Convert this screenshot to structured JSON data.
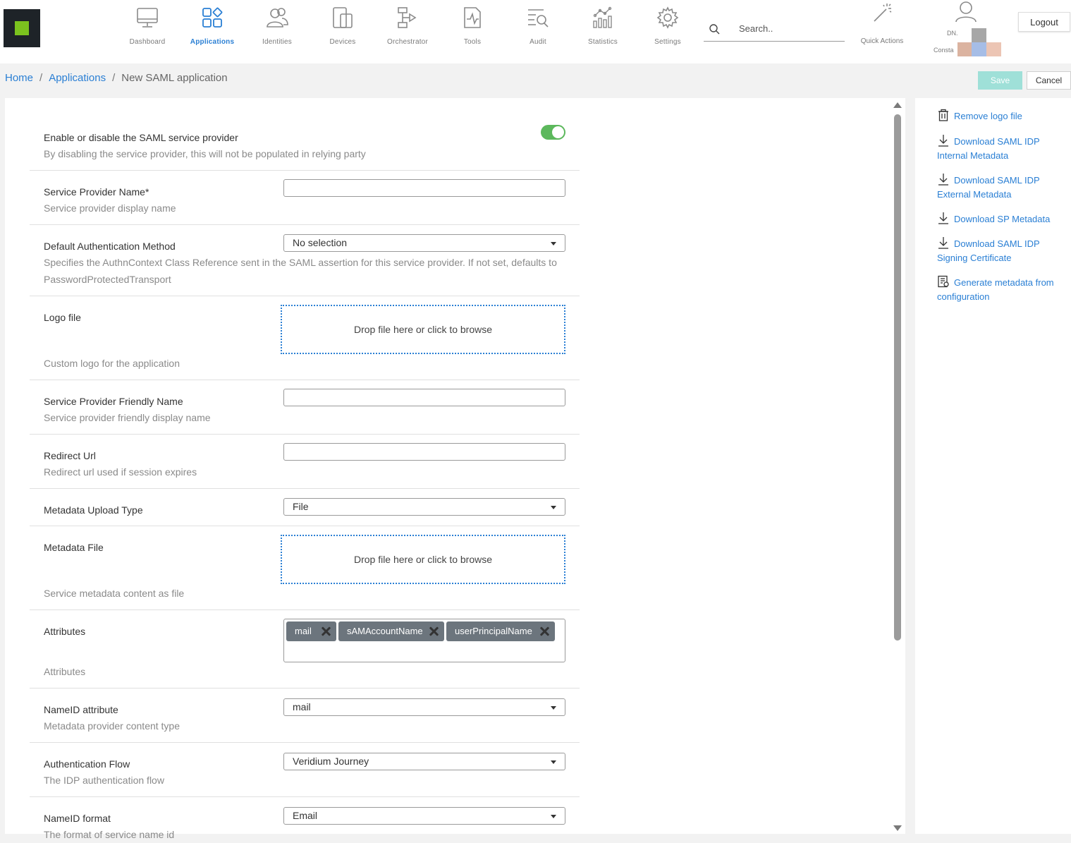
{
  "nav": [
    {
      "label": "Dashboard",
      "icon": "monitor-icon",
      "active": false
    },
    {
      "label": "Applications",
      "icon": "applications-icon",
      "active": true
    },
    {
      "label": "Identities",
      "icon": "identities-icon",
      "active": false
    },
    {
      "label": "Devices",
      "icon": "devices-icon",
      "active": false
    },
    {
      "label": "Orchestrator",
      "icon": "orchestrator-icon",
      "active": false
    },
    {
      "label": "Tools",
      "icon": "tools-icon",
      "active": false
    },
    {
      "label": "Audit",
      "icon": "audit-icon",
      "active": false
    },
    {
      "label": "Statistics",
      "icon": "statistics-icon",
      "active": false
    },
    {
      "label": "Settings",
      "icon": "gear-icon",
      "active": false
    }
  ],
  "search": {
    "placeholder": "Search.."
  },
  "quick_actions": {
    "label": "Quick Actions"
  },
  "user": {
    "dn_label": "DN.",
    "name_partial": "Consta"
  },
  "logout_label": "Logout",
  "breadcrumb": {
    "home": "Home",
    "applications": "Applications",
    "current": "New SAML application"
  },
  "toolbar": {
    "save_label": "Save",
    "cancel_label": "Cancel"
  },
  "form": {
    "enable": {
      "label": "Enable or disable the SAML service provider",
      "desc": "By disabling the service provider, this will not be populated in relying party",
      "enabled": true
    },
    "sp_name": {
      "label": "Service Provider Name*",
      "desc": "Service provider display name",
      "value": ""
    },
    "auth_method": {
      "label": "Default Authentication Method",
      "desc": "Specifies the AuthnContext Class Reference sent in the SAML assertion for this service provider. If not set, defaults to PasswordProtectedTransport",
      "value": "No selection"
    },
    "logo_file": {
      "label": "Logo file",
      "desc": "Custom logo for the application",
      "drop_text": "Drop file here or click to browse"
    },
    "friendly_name": {
      "label": "Service Provider Friendly Name",
      "desc": "Service provider friendly display name",
      "value": ""
    },
    "redirect_url": {
      "label": "Redirect Url",
      "desc": "Redirect url used if session expires",
      "value": ""
    },
    "metadata_upload_type": {
      "label": "Metadata Upload Type",
      "value": "File"
    },
    "metadata_file": {
      "label": "Metadata File",
      "desc": "Service metadata content as file",
      "drop_text": "Drop file here or click to browse"
    },
    "attributes": {
      "label": "Attributes",
      "desc": "Attributes",
      "tags": [
        "mail",
        "sAMAccountName",
        "userPrincipalName"
      ]
    },
    "nameid_attribute": {
      "label": "NameID attribute",
      "desc": "Metadata provider content type",
      "value": "mail"
    },
    "auth_flow": {
      "label": "Authentication Flow",
      "desc": "The IDP authentication flow",
      "value": "Veridium Journey"
    },
    "nameid_format": {
      "label": "NameID format",
      "desc": "The format of service name id",
      "value": "Email"
    }
  },
  "side_actions": [
    {
      "label": "Remove logo file",
      "icon": "trash-icon"
    },
    {
      "label": "Download SAML IDP Internal Metadata",
      "icon": "download-icon"
    },
    {
      "label": "Download SAML IDP External Metadata",
      "icon": "download-icon"
    },
    {
      "label": "Download SP Metadata",
      "icon": "download-icon"
    },
    {
      "label": "Download SAML IDP Signing Certificate",
      "icon": "download-icon"
    },
    {
      "label": "Generate metadata from configuration",
      "icon": "document-icon"
    }
  ],
  "colors": {
    "accent": "#2a7fd4",
    "logo_bg": "#1e2328",
    "logo_mark": "#7bc21e",
    "toggle_on": "#5cb85c",
    "save_disabled": "#9fe0d8",
    "tag_bg": "#6c757d"
  }
}
